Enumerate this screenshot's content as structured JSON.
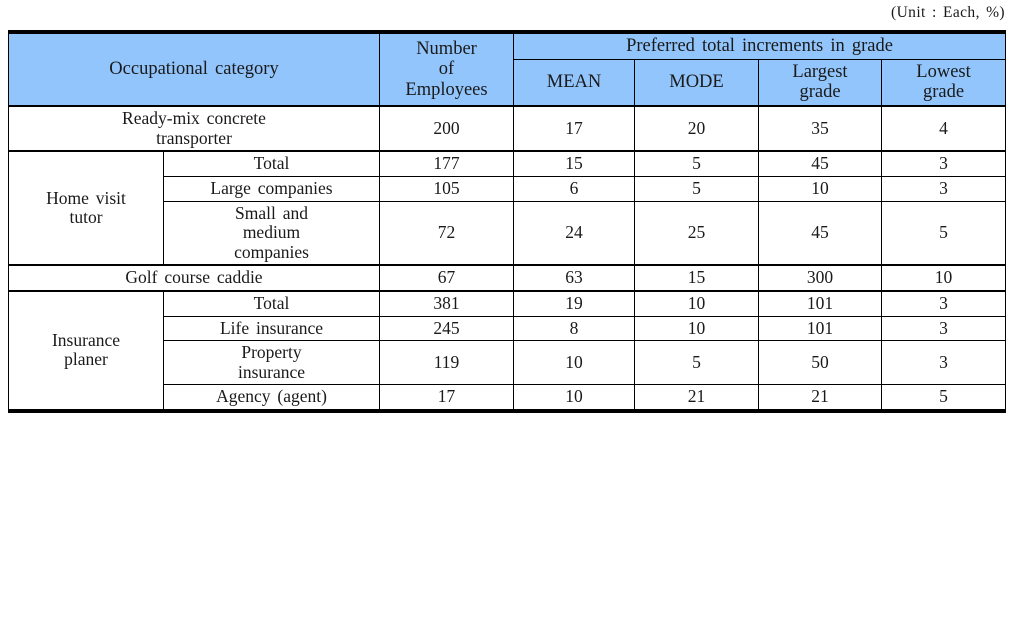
{
  "unit_note": "(Unit : Each, %)",
  "table": {
    "headers": {
      "occupational_category": "Occupational category",
      "number_of_employees_line1": "Number",
      "number_of_employees_line2": "of",
      "number_of_employees_line3": "Employees",
      "preferred_group": "Preferred total increments in grade",
      "mean": "MEAN",
      "mode": "MODE",
      "largest_grade_line1": "Largest",
      "largest_grade_line2": "grade",
      "lowest_grade_line1": "Lowest",
      "lowest_grade_line2": "grade"
    },
    "groups": [
      {
        "name_line1": "Ready-mix concrete",
        "name_line2": "transporter",
        "rows": [
          {
            "sub": null,
            "employees": "200",
            "mean": "17",
            "mode": "20",
            "largest": "35",
            "lowest": "4"
          }
        ]
      },
      {
        "name_line1": "Home visit",
        "name_line2": "tutor",
        "rows": [
          {
            "sub": "Total",
            "employees": "177",
            "mean": "15",
            "mode": "5",
            "largest": "45",
            "lowest": "3"
          },
          {
            "sub": "Large companies",
            "employees": "105",
            "mean": "6",
            "mode": "5",
            "largest": "10",
            "lowest": "3"
          },
          {
            "sub_line1": "Small and",
            "sub_line2": "medium",
            "sub_line3": "companies",
            "employees": "72",
            "mean": "24",
            "mode": "25",
            "largest": "45",
            "lowest": "5"
          }
        ]
      },
      {
        "name_line1": "Golf course caddie",
        "name_line2": "",
        "rows": [
          {
            "sub": null,
            "employees": "67",
            "mean": "63",
            "mode": "15",
            "largest": "300",
            "lowest": "10"
          }
        ]
      },
      {
        "name_line1": "Insurance",
        "name_line2": "planer",
        "rows": [
          {
            "sub": "Total",
            "employees": "381",
            "mean": "19",
            "mode": "10",
            "largest": "101",
            "lowest": "3"
          },
          {
            "sub": "Life insurance",
            "employees": "245",
            "mean": "8",
            "mode": "10",
            "largest": "101",
            "lowest": "3"
          },
          {
            "sub_line1": "Property",
            "sub_line2": "insurance",
            "employees": "119",
            "mean": "10",
            "mode": "5",
            "largest": "50",
            "lowest": "3"
          },
          {
            "sub": "Agency (agent)",
            "employees": "17",
            "mean": "10",
            "mode": "21",
            "largest": "21",
            "lowest": "5"
          }
        ]
      }
    ]
  },
  "colors": {
    "header_background": "#92c5fc",
    "border": "#000000",
    "text": "#1a1a1a",
    "page_background": "#ffffff"
  }
}
